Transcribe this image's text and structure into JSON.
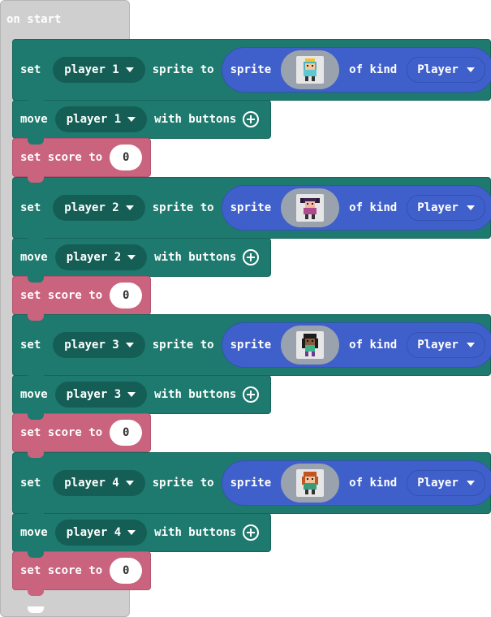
{
  "hat": {
    "label": "on start"
  },
  "keywords": {
    "set": "set",
    "sprite_to": "sprite to",
    "sprite": "sprite",
    "of_kind": "of kind",
    "move": "move",
    "with_buttons": "with buttons",
    "set_score_to": "set score to"
  },
  "groups": [
    {
      "player": "player 1",
      "kind": "Player",
      "score": "0",
      "sprite_icon": "sprite-player-1-icon"
    },
    {
      "player": "player 2",
      "kind": "Player",
      "score": "0",
      "sprite_icon": "sprite-player-2-icon"
    },
    {
      "player": "player 3",
      "kind": "Player",
      "score": "0",
      "sprite_icon": "sprite-player-3-icon"
    },
    {
      "player": "player 4",
      "kind": "Player",
      "score": "0",
      "sprite_icon": "sprite-player-4-icon"
    }
  ],
  "colors": {
    "sprites_block": "#1e7a6e",
    "info_block": "#c9637e",
    "sprite_pill": "#3f5fcb",
    "event_block": "#cfcfcf"
  }
}
